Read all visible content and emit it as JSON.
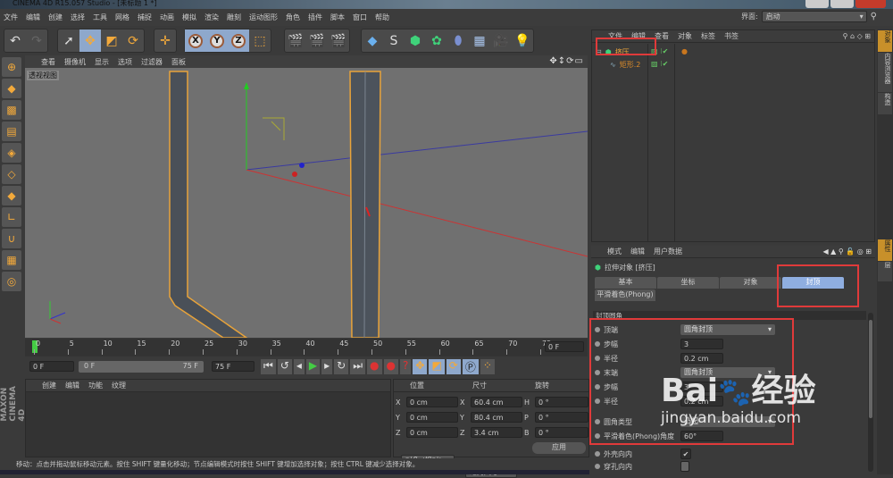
{
  "window": {
    "title": "CINEMA 4D R15.057 Studio - [未标题 1 *]"
  },
  "menu": [
    "文件",
    "编辑",
    "创建",
    "选择",
    "工具",
    "网格",
    "捕捉",
    "动画",
    "模拟",
    "渲染",
    "雕刻",
    "运动图形",
    "角色",
    "插件",
    "脚本",
    "窗口",
    "帮助"
  ],
  "layout": {
    "label": "界面:",
    "value": "启动"
  },
  "viewport": {
    "menu": [
      "查看",
      "摄像机",
      "显示",
      "选项",
      "过滤器",
      "面板"
    ],
    "label": "透视视图"
  },
  "object_manager": {
    "menu": [
      "文件",
      "编辑",
      "查看",
      "对象",
      "标签",
      "书签"
    ],
    "objects": [
      {
        "name": "挤压"
      },
      {
        "name": "矩形.2"
      }
    ]
  },
  "attribute_manager": {
    "menu": [
      "模式",
      "编辑",
      "用户数据"
    ],
    "object_title": "拉伸对象 [挤压]",
    "tabs": [
      "基本",
      "坐标",
      "对象",
      "封顶"
    ],
    "tab2": "平滑着色(Phong)",
    "active_tab": "封顶",
    "section": "封顶圆角",
    "props": [
      {
        "label": "顶端",
        "value": "圆角封顶",
        "type": "dropdown"
      },
      {
        "label": "步幅",
        "value": "3",
        "type": "field"
      },
      {
        "label": "半径",
        "value": "0.2 cm",
        "type": "field"
      },
      {
        "label": "末端",
        "value": "圆角封顶",
        "type": "dropdown"
      },
      {
        "label": "步幅",
        "value": "3",
        "type": "field"
      },
      {
        "label": "半径",
        "value": "0.2 cm",
        "type": "field"
      },
      {
        "label": "圆角类型",
        "value": "凸起",
        "type": "dropdown"
      },
      {
        "label": "平滑着色(Phong)角度",
        "value": "60°",
        "type": "field"
      },
      {
        "label": "外壳向内",
        "value": "✔",
        "type": "check"
      },
      {
        "label": "穿孔向内",
        "value": "",
        "type": "check"
      }
    ]
  },
  "right_tabs": [
    "对象",
    "内容浏览器",
    "构造",
    "属性",
    "层"
  ],
  "timeline": {
    "ticks": [
      "0",
      "5",
      "10",
      "15",
      "20",
      "25",
      "30",
      "35",
      "40",
      "45",
      "50",
      "55",
      "60",
      "65",
      "70",
      "75"
    ],
    "current": "0 F"
  },
  "transport": {
    "start": "0 F",
    "range_start": "0 F",
    "range_end": "75 F",
    "end": "75 F"
  },
  "material_manager": {
    "menu": [
      "创建",
      "编辑",
      "功能",
      "纹理"
    ]
  },
  "coordinates": {
    "headers": [
      "位置",
      "尺寸",
      "旋转"
    ],
    "rows": [
      {
        "a": "X",
        "pos": "0 cm",
        "b": "X",
        "size": "60.4 cm",
        "c": "H",
        "rot": "0 °"
      },
      {
        "a": "Y",
        "pos": "0 cm",
        "b": "Y",
        "size": "80.4 cm",
        "c": "P",
        "rot": "0 °"
      },
      {
        "a": "Z",
        "pos": "0 cm",
        "b": "Z",
        "size": "3.4 cm",
        "c": "B",
        "rot": "0 °"
      }
    ],
    "mode": "对象 (相对)",
    "size_mode": "绝对尺寸",
    "apply": "应用"
  },
  "status": "移动：点击并拖动鼠标移动元素。按住 SHIFT 键量化移动；节点编辑模式时按住 SHIFT 键增加选择对象；按住 CTRL 键减少选择对象。",
  "branding": "MAXON CINEMA 4D",
  "watermark": {
    "logo": "Bai du 经验",
    "url": "jingyan.baidu.com"
  },
  "colors": {
    "accent": "#8faee0",
    "highlight": "#f2a93b",
    "annotation": "#e03a3a"
  }
}
